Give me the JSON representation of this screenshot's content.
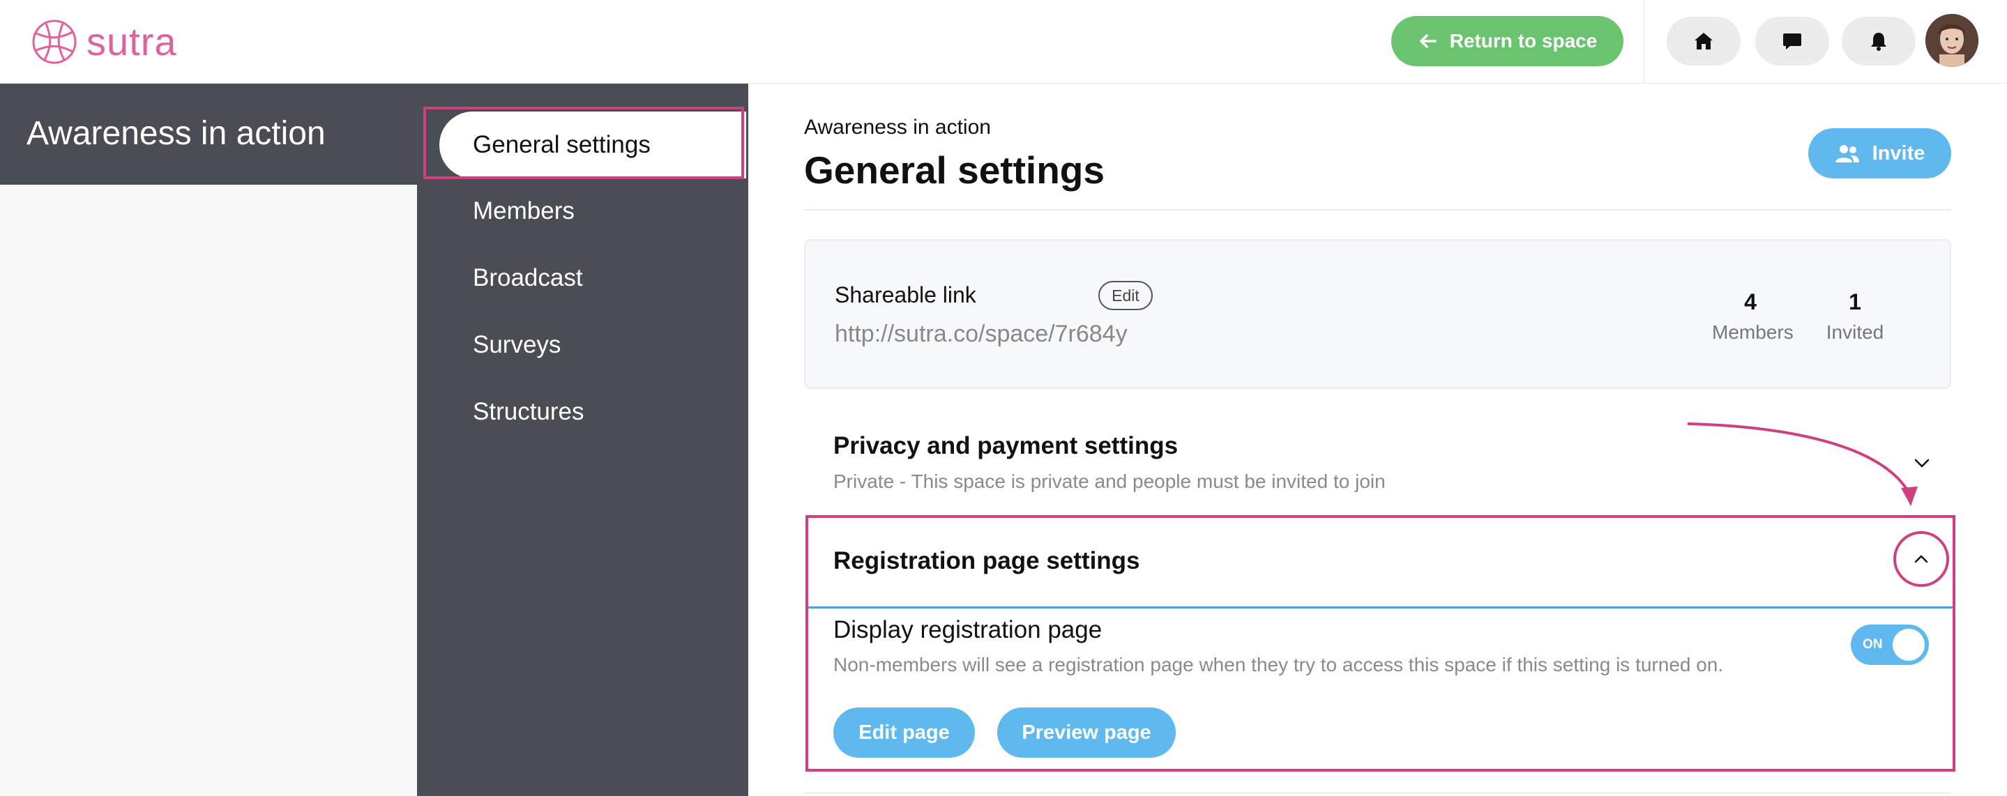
{
  "app": {
    "logo_text": "sutra",
    "brand_color": "#e0619f",
    "accent_green": "#69c36f",
    "accent_blue": "#5fb8ee",
    "annotation_color": "#d13f7f"
  },
  "topbar": {
    "return_label": "Return to space",
    "icons": [
      "home-icon",
      "chat-icon",
      "bell-icon"
    ]
  },
  "space": {
    "name": "Awareness in action"
  },
  "nav": {
    "items": [
      {
        "label": "General settings",
        "active": true
      },
      {
        "label": "Members"
      },
      {
        "label": "Broadcast"
      },
      {
        "label": "Surveys"
      },
      {
        "label": "Structures"
      }
    ]
  },
  "main": {
    "breadcrumb": "Awareness in action",
    "title": "General settings",
    "invite_label": "Invite",
    "link_card": {
      "label": "Shareable link",
      "edit_label": "Edit",
      "url": "http://sutra.co/space/7r684y",
      "stats": [
        {
          "value": "4",
          "label": "Members"
        },
        {
          "value": "1",
          "label": "Invited"
        }
      ]
    },
    "privacy": {
      "title": "Privacy and payment settings",
      "description": "Private - This space is private and people must be invited to join"
    },
    "registration": {
      "title": "Registration page settings",
      "display_title": "Display registration page",
      "display_desc": "Non-members will see a registration page when they try to access this space if this setting is turned on.",
      "toggle_label": "ON",
      "edit_label": "Edit page",
      "preview_label": "Preview page"
    }
  }
}
